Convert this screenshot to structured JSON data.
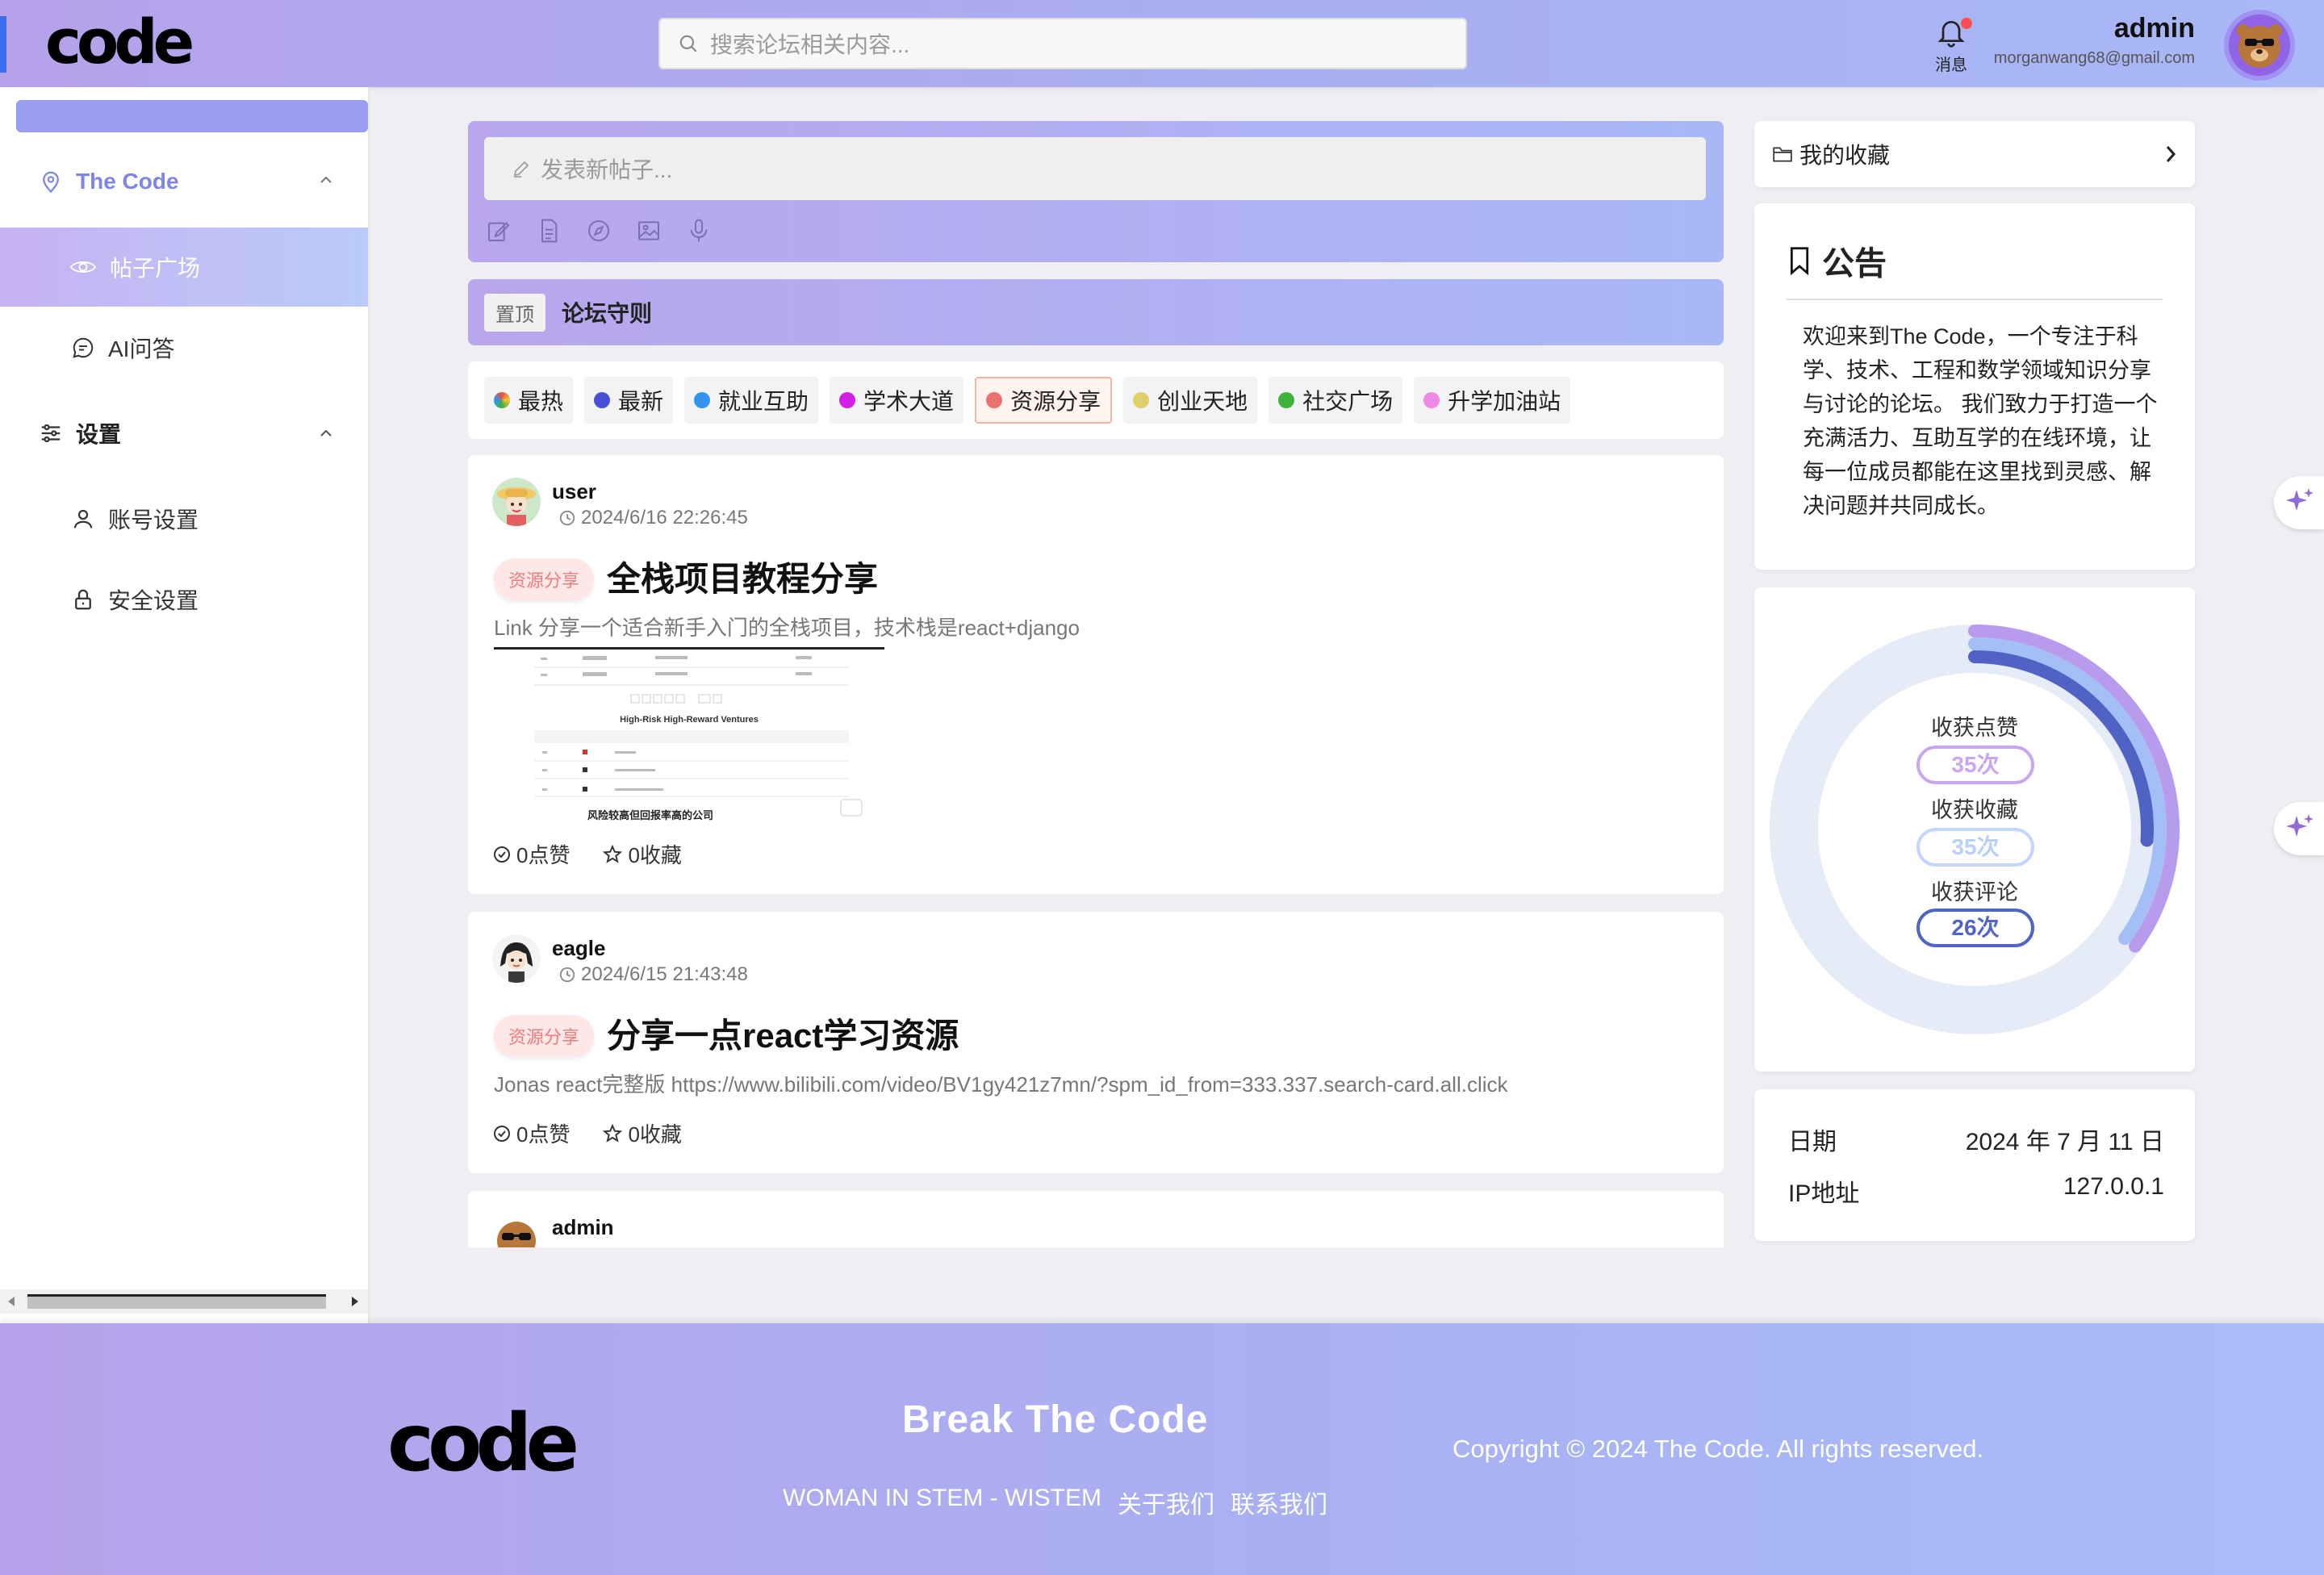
{
  "header": {
    "logo": "code",
    "search_placeholder": "搜索论坛相关内容...",
    "bell_label": "消息",
    "user_name": "admin",
    "user_email": "morganwang68@gmail.com"
  },
  "sidebar": {
    "section_code": "The Code",
    "items": [
      {
        "label": "帖子广场"
      },
      {
        "label": "AI问答"
      }
    ],
    "section_settings": "设置",
    "settings_items": [
      {
        "label": "账号设置"
      },
      {
        "label": "安全设置"
      }
    ]
  },
  "compose": {
    "placeholder": "发表新帖子..."
  },
  "pinned": {
    "tag": "置顶",
    "title": "论坛守则"
  },
  "categories": [
    {
      "label": "最热",
      "color": "#e5533d"
    },
    {
      "label": "最新",
      "color": "#4a4fd8"
    },
    {
      "label": "就业互助",
      "color": "#2f95f0"
    },
    {
      "label": "学术大道",
      "color": "#d41ee6"
    },
    {
      "label": "资源分享",
      "color": "#e87070"
    },
    {
      "label": "创业天地",
      "color": "#e2cf6a"
    },
    {
      "label": "社交广场",
      "color": "#3fb23a"
    },
    {
      "label": "升学加油站",
      "color": "#ee8ae6"
    }
  ],
  "posts": [
    {
      "user": "user",
      "time": "2024/6/16 22:26:45",
      "tag": "资源分享",
      "title": "全栈项目教程分享",
      "desc": "Link 分享一个适合新手入门的全栈项目，技术栈是react+django",
      "likes": "0点赞",
      "favs": "0收藏",
      "thumb_caption": "High-Risk High-Reward Ventures",
      "thumb_subtitle": "风险较高但回报率高的公司"
    },
    {
      "user": "eagle",
      "time": "2024/6/15 21:43:48",
      "tag": "资源分享",
      "title": "分享一点react学习资源",
      "desc": "Jonas react完整版 https://www.bilibili.com/video/BV1gy421z7mn/?spm_id_from=333.337.search-card.all.click",
      "likes": "0点赞",
      "favs": "0收藏"
    },
    {
      "user": "admin"
    }
  ],
  "right": {
    "favorites": "我的收藏",
    "notice_title": "公告",
    "notice_body": "欢迎来到The Code，一个专注于科学、技术、工程和数学领域知识分享与讨论的论坛。 我们致力于打造一个充满活力、互助互学的在线环境，让每一位成员都能在这里找到灵感、解决问题并共同成长。",
    "stats": [
      {
        "label": "收获点赞",
        "value": "35次",
        "count": 35,
        "color": "#c9a6f2"
      },
      {
        "label": "收获收藏",
        "value": "35次",
        "count": 35,
        "color": "#b8cff8"
      },
      {
        "label": "收获评论",
        "value": "26次",
        "count": 26,
        "color": "#4f63c8"
      }
    ],
    "date_label": "日期",
    "date_value": "2024 年 7 月 11 日",
    "ip_label": "IP地址",
    "ip_value": "127.0.0.1"
  },
  "footer": {
    "logo": "code",
    "slogan": "Break The Code",
    "links": [
      "WOMAN IN STEM - WISTEM",
      "关于我们",
      "联系我们"
    ],
    "copyright": "Copyright © 2024 The Code. All rights reserved."
  }
}
